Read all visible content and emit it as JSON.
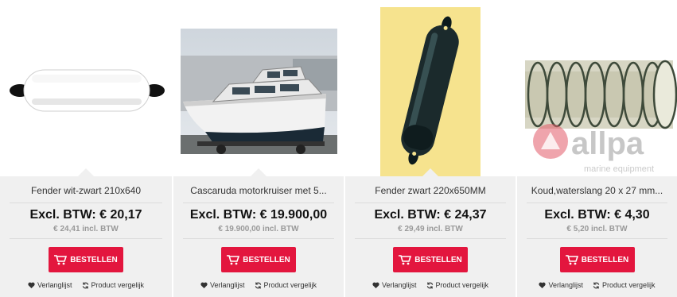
{
  "products": [
    {
      "title": "Fender wit-zwart 210x640",
      "price_excl": "Excl. BTW: € 20,17",
      "price_incl": "€ 24,41  incl. BTW",
      "button_label": "BESTELLEN",
      "wishlist_label": "Verlanglijst",
      "compare_label": "Product vergelijk",
      "image_icon": "white-fender-image"
    },
    {
      "title": "Cascaruda motorkruiser met 5...",
      "price_excl": "Excl. BTW: € 19.900,00",
      "price_incl": "€ 19.900,00  incl. BTW",
      "button_label": "BESTELLEN",
      "wishlist_label": "Verlanglijst",
      "compare_label": "Product vergelijk",
      "image_icon": "motor-boat-image"
    },
    {
      "title": "Fender zwart 220x650MM",
      "price_excl": "Excl. BTW: € 24,37",
      "price_incl": "€ 29,49  incl. BTW",
      "button_label": "BESTELLEN",
      "wishlist_label": "Verlanglijst",
      "compare_label": "Product vergelijk",
      "image_icon": "black-fender-image"
    },
    {
      "title": "Koud,waterslang 20 x 27 mm...",
      "price_excl": "Excl. BTW: € 4,30",
      "price_incl": "€ 5,20  incl. BTW",
      "button_label": "BESTELLEN",
      "wishlist_label": "Verlanglijst",
      "compare_label": "Product vergelijk",
      "image_icon": "spiral-hose-image",
      "watermark_text": "allpa",
      "watermark_sub": "marine equipment"
    }
  ],
  "colors": {
    "accent": "#e3163e",
    "card_bg": "#f0f0f0"
  }
}
